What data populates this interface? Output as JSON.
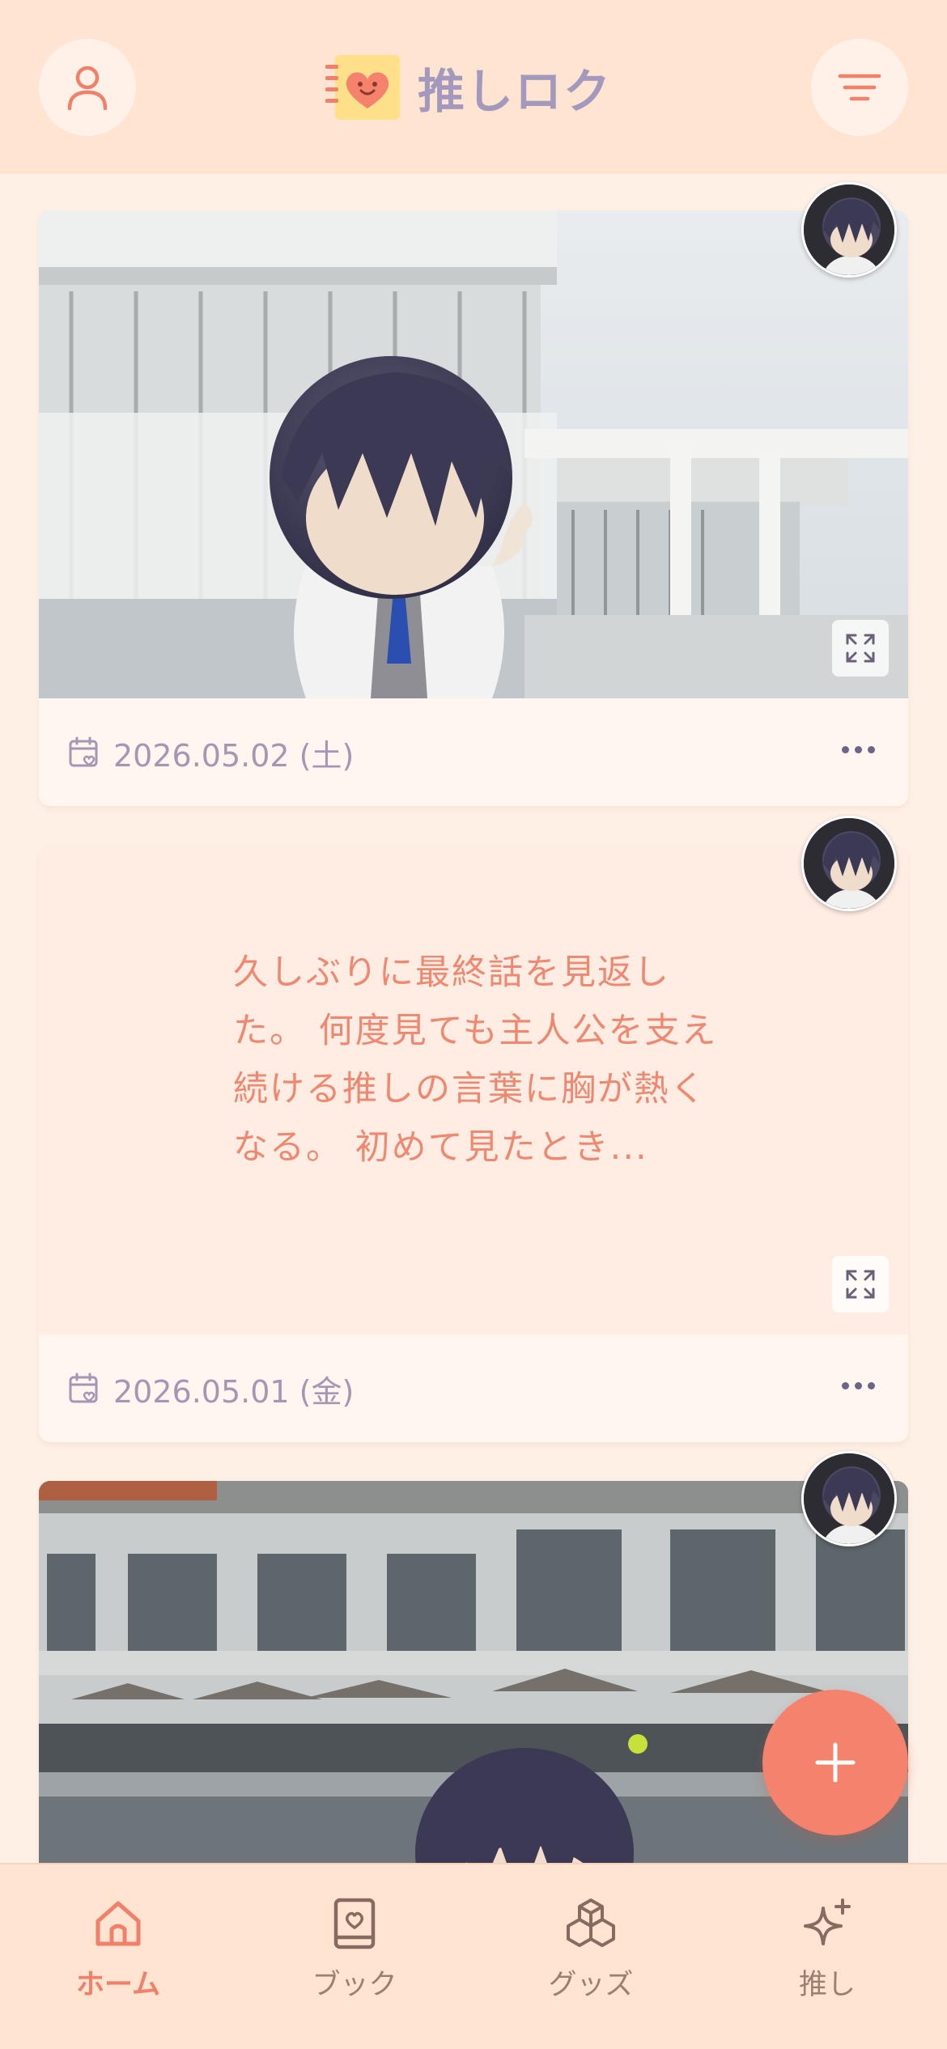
{
  "header": {
    "app_title": "推しロク",
    "profile_icon": "user-icon",
    "filter_icon": "filter-lines-icon"
  },
  "feed": [
    {
      "type": "photo",
      "date": "2026.05.02 (土)"
    },
    {
      "type": "text",
      "memo": "久しぶりに最終話を見返した。 何度見ても主人公を支え続ける推しの言葉に胸が熱くなる。 初めて見たとき...",
      "date": "2026.05.01 (金)"
    },
    {
      "type": "photo"
    }
  ],
  "nav": {
    "home": "ホーム",
    "book": "ブック",
    "goods": "グッズ",
    "oshi": "推し"
  },
  "colors": {
    "accent": "#f4826c",
    "header_bg": "#ffe4d2",
    "page_bg": "#fff0e6",
    "logo_text": "#a399bc",
    "memo_text": "#ee8870"
  }
}
